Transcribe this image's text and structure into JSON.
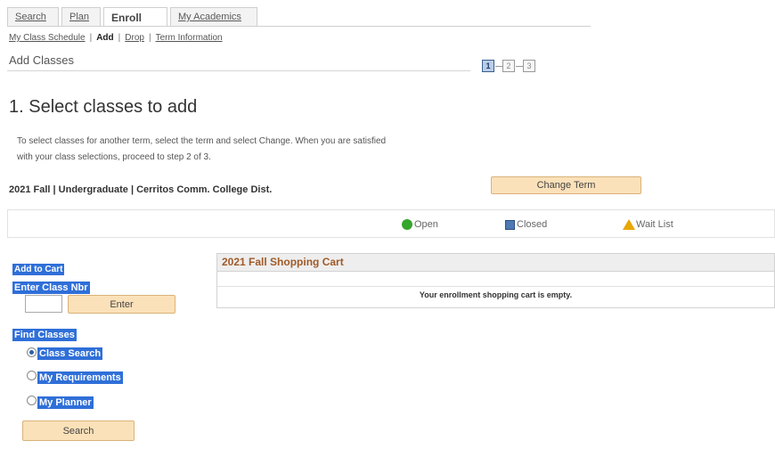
{
  "tabs": [
    {
      "label": "Search",
      "active": false
    },
    {
      "label": "Plan",
      "active": false
    },
    {
      "label": "Enroll",
      "active": true
    },
    {
      "label": "My Academics",
      "active": false
    }
  ],
  "sublinks": {
    "schedule": "My Class Schedule",
    "add": "Add",
    "drop": "Drop",
    "term_info": "Term Information",
    "separator": "|"
  },
  "page_title": "Add Classes",
  "steps": [
    "1",
    "2",
    "3"
  ],
  "current_step": 1,
  "heading": "1.  Select classes to add",
  "instructions": {
    "line1": "To select classes for another term, select the term and select Change.  When you are satisfied",
    "line2": "with your class selections, proceed to step 2 of 3."
  },
  "term_text": "2021 Fall | Undergraduate | Cerritos Comm. College Dist.",
  "change_term_label": "Change Term",
  "legend": {
    "open": "Open",
    "closed": "Closed",
    "wait_list": "Wait List"
  },
  "left": {
    "add_to_cart": "Add to Cart",
    "enter_class_nbr": "Enter Class Nbr",
    "class_nbr_value": "",
    "enter_label": "Enter",
    "find_classes": "Find Classes",
    "options": [
      {
        "label": "Class Search",
        "selected": true
      },
      {
        "label": "My Requirements",
        "selected": false
      },
      {
        "label": "My Planner",
        "selected": false
      }
    ],
    "search_label": "Search"
  },
  "cart": {
    "title": "2021 Fall Shopping Cart",
    "empty_message": "Your enrollment shopping cart is empty."
  },
  "colors": {
    "button_fill": "#fbe1b9",
    "highlight": "#2f6fd8",
    "open": "#35a62c",
    "closed": "#4e79b5",
    "wait_list": "#e9a600",
    "cart_title": "#a05a28"
  }
}
